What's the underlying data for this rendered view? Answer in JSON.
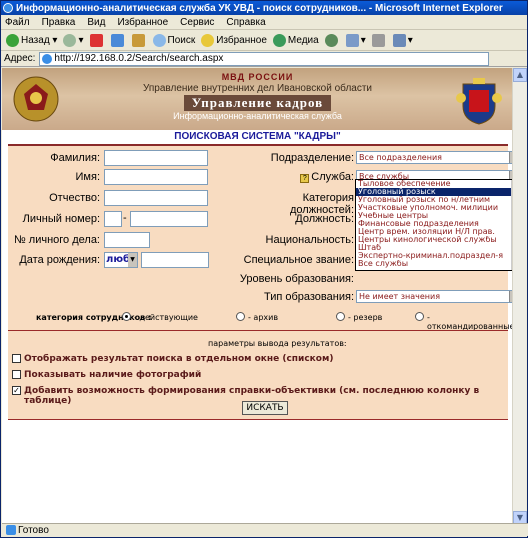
{
  "window": {
    "title": "Информационно-аналитическая служба УК УВД - поиск сотрудников... - Microsoft Internet Explorer"
  },
  "menu": [
    "Файл",
    "Правка",
    "Вид",
    "Избранное",
    "Сервис",
    "Справка"
  ],
  "toolbar": {
    "back": "Назад",
    "search": "Поиск",
    "favorites": "Избранное",
    "media": "Медиа"
  },
  "address": {
    "label": "Адрес:",
    "url": "http://192.168.0.2/Search/search.aspx"
  },
  "banner": {
    "line1": "МВД РОССИИ",
    "line2": "Управление внутренних дел Ивановской области",
    "line3": "Управление кадров",
    "line4": "Информационно-аналитическая служба"
  },
  "system_title": "ПОИСКОВАЯ СИСТЕМА \"КАДРЫ\"",
  "form": {
    "surname": "Фамилия:",
    "name": "Имя:",
    "patronymic": "Отчество:",
    "personal_number": "Личный номер:",
    "file_number": "№ личного дела:",
    "birth_date": "Дата рождения:",
    "birth_date_select": "люб",
    "subdivision": "Подразделение:",
    "subdivision_value": "Все подразделения",
    "service": "Служба:",
    "service_value": "Все службы",
    "position_category": "Категория должностей:",
    "position": "Должность:",
    "nationality": "Национальность:",
    "special_rank": "Специальное звание:",
    "education_level": "Уровень образования:",
    "education_type": "Тип образования:",
    "education_type_value": "Не имеет значения"
  },
  "service_options": [
    "Тыловое обеспечение",
    "Уголовный розыск",
    "Уголовный розыск по н/летним",
    "Участковые уполномоч. милиции",
    "Учебные центры",
    "Финансовые подразделения",
    "Центр врем. изоляции Н/Л прав.",
    "Центры кинологической службы",
    "Штаб",
    "Экспертно-криминал.подраздел-я",
    "Все службы"
  ],
  "service_selected_index": 1,
  "category": {
    "label": "категория сотрудников :",
    "options": [
      "- действующие",
      "- архив",
      "- резерв",
      "- откомандированные"
    ],
    "selected": 0
  },
  "output": {
    "label": "параметры вывода результатов:",
    "options": [
      {
        "label": "Отображать результат поиска в отдельном окне (списком)",
        "checked": false
      },
      {
        "label": "Показывать наличие фотографий",
        "checked": false
      },
      {
        "label": "Добавить возможность формирования справки-объективки (см. последнюю колонку в таблице)",
        "checked": true
      }
    ]
  },
  "search_button": "ИСКАТЬ",
  "status": "Готово"
}
